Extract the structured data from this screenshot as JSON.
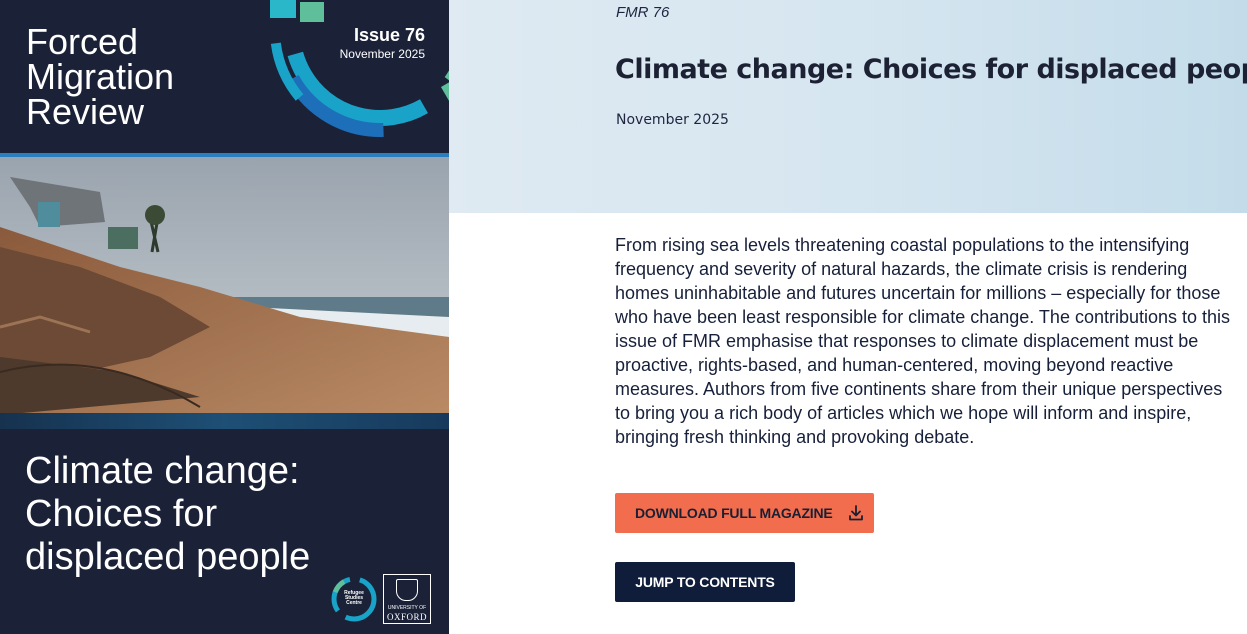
{
  "cover": {
    "magazine_title_lines": [
      "Forced",
      "Migration",
      "Review"
    ],
    "issue_number": "Issue 76",
    "issue_date": "November 2025",
    "title_lines": [
      "Climate change:",
      "Choices for",
      "displaced people"
    ],
    "logo_rsc_text": "Refugee Studies Centre",
    "logo_oxford_university": "UNIVERSITY OF",
    "logo_oxford_name": "OXFORD",
    "colors": {
      "background": "#1b2238",
      "arc_teal": "#1aa3c9",
      "arc_blue": "#1c6fb8",
      "arc_green": "#5fbf9a"
    }
  },
  "header": {
    "kicker": "FMR 76",
    "title": "Climate change: Choices for displaced people",
    "date": "November 2025"
  },
  "intro": {
    "text": "From rising sea levels threatening coastal populations to the intensifying frequency and severity of natural hazards, the climate crisis is rendering homes uninhabitable and futures uncertain for millions – especially for those who have been least responsible for climate change. The contributions to this issue of FMR emphasise that responses to climate displacement must be proactive, rights-based, and human-centered, moving beyond reactive measures. Authors from five continents share from their unique perspectives to bring you a rich body of articles which we hope will inform and inspire, bringing fresh thinking and provoking debate."
  },
  "actions": {
    "download_label": "DOWNLOAD FULL MAGAZINE",
    "download_icon": "download-icon",
    "contents_label": "JUMP TO CONTENTS",
    "colors": {
      "download_bg": "#f26d4d",
      "contents_bg": "#0f1c3a"
    }
  }
}
